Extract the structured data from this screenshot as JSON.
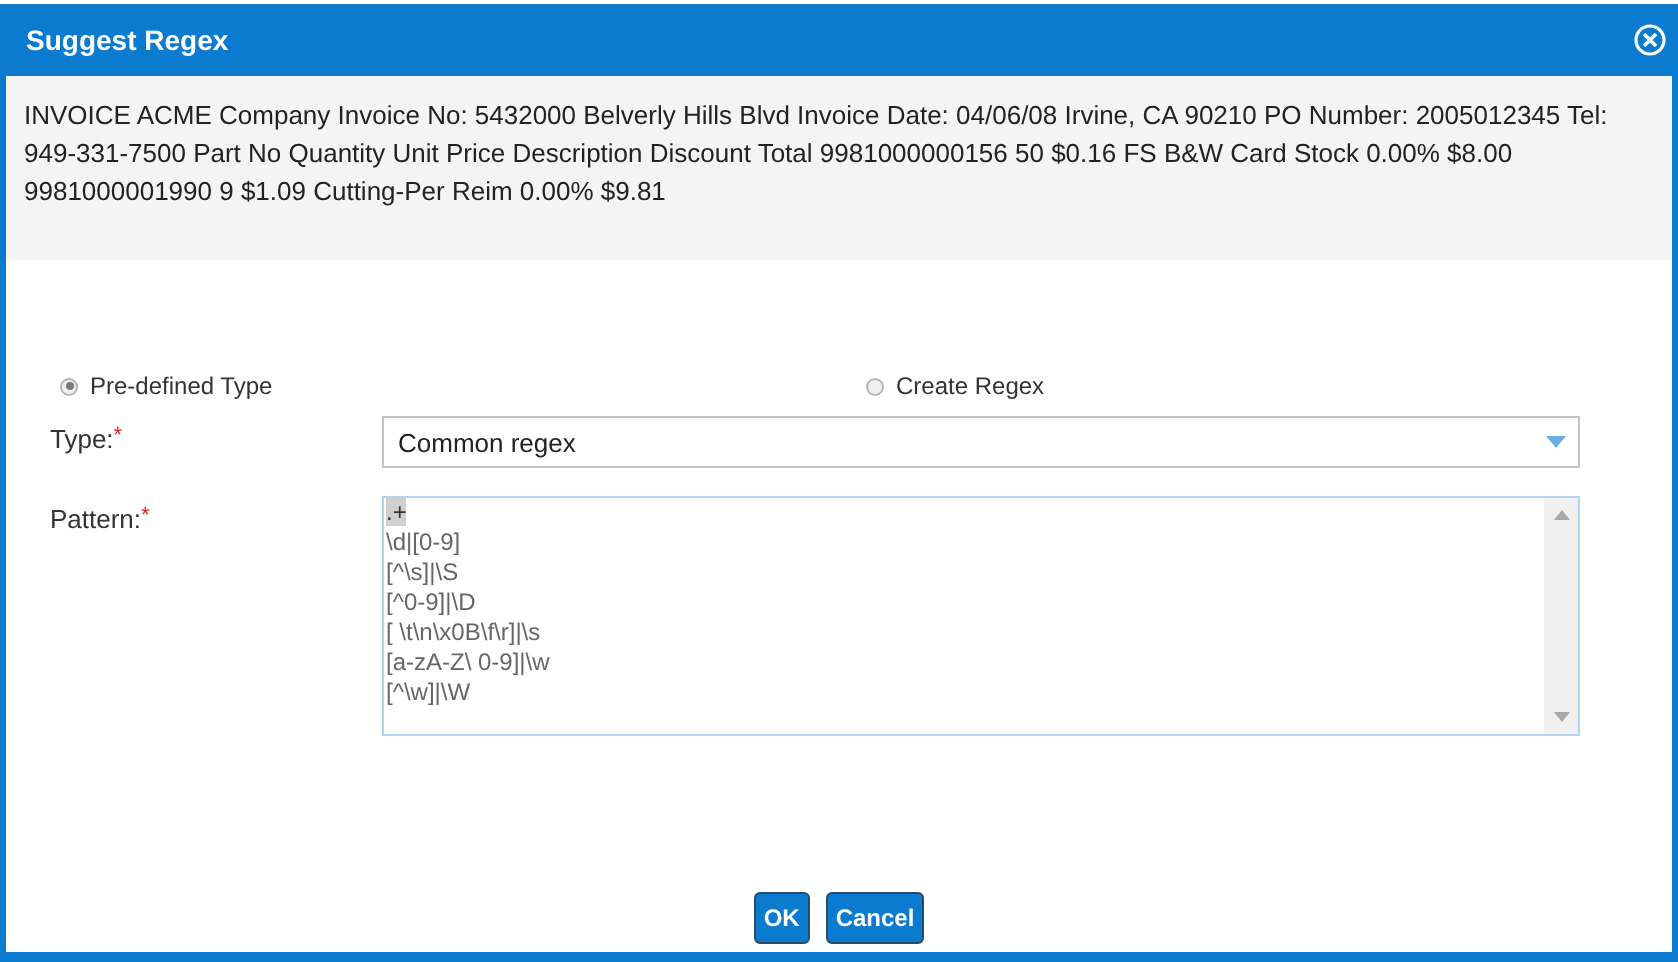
{
  "window": {
    "title": "Suggest Regex"
  },
  "sample_text": "INVOICE ACME Company Invoice No: 5432000 Belverly Hills Blvd Invoice Date: 04/06/08 Irvine, CA 90210 PO Number: 2005012345 Tel: 949-331-7500 Part No Quantity Unit Price Description Discount Total 9981000000156 50 $0.16 FS B&W Card Stock 0.00% $8.00 9981000001990 9 $1.09 Cutting-Per Reim 0.00% $9.81",
  "mode_options": [
    {
      "label": "Pre-defined Type",
      "selected": true
    },
    {
      "label": "Create Regex",
      "selected": false
    }
  ],
  "type_field": {
    "label": "Type:",
    "required_mark": "*",
    "value": "Common regex"
  },
  "pattern_field": {
    "label": "Pattern:",
    "required_mark": "*",
    "lines": [
      {
        "text": ".+",
        "selected": true
      },
      {
        "text": "\\d|[0-9]",
        "selected": false
      },
      {
        "text": "[^\\s]|\\S",
        "selected": false
      },
      {
        "text": "[^0-9]|\\D",
        "selected": false
      },
      {
        "text": "[ \\t\\n\\x0B\\f\\r]|\\s",
        "selected": false
      },
      {
        "text": "[a-zA-Z\\ 0-9]|\\w",
        "selected": false
      },
      {
        "text": "[^\\w]|\\W",
        "selected": false
      }
    ]
  },
  "buttons": [
    "OK",
    "Cancel"
  ]
}
